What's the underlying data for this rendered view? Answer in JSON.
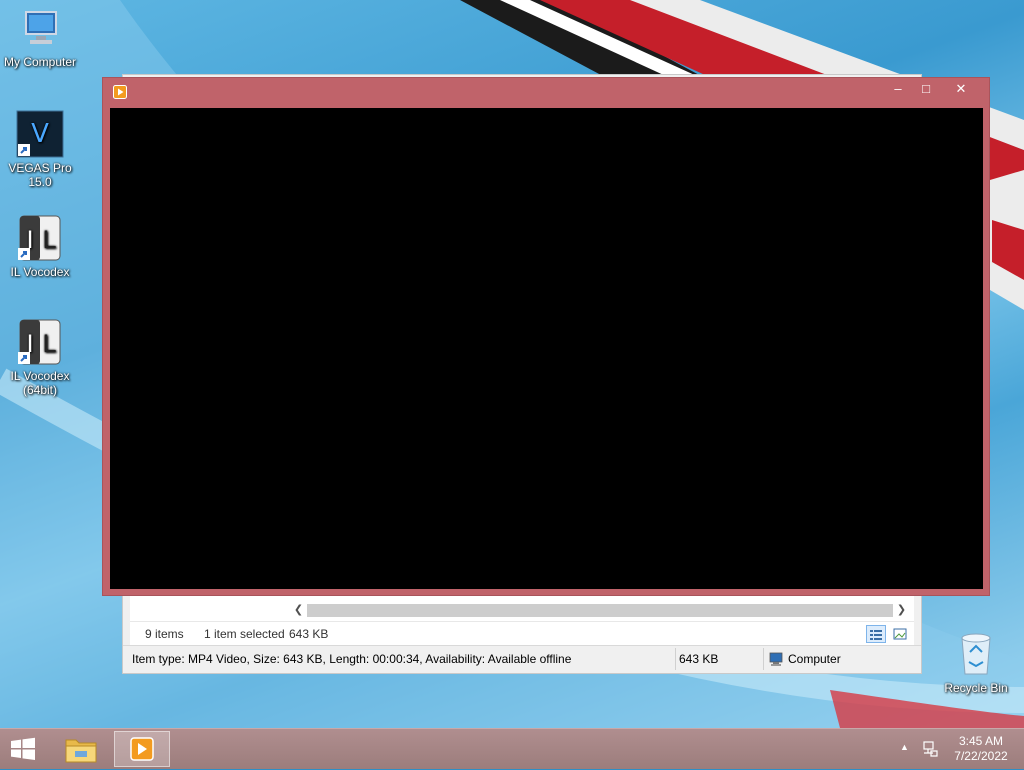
{
  "desktop": {
    "icons": [
      {
        "label": "My Computer",
        "icon": "computer-icon"
      },
      {
        "label_line1": "VEGAS Pro",
        "label_line2": "15.0",
        "icon": "vegas-pro-icon"
      },
      {
        "label": "IL Vocodex",
        "icon": "il-vocodex-icon"
      },
      {
        "label_line1": "IL Vocodex",
        "label_line2": "(64bit)",
        "icon": "il-vocodex-icon"
      },
      {
        "label": "Recycle Bin",
        "icon": "recycle-bin-icon"
      }
    ]
  },
  "explorer": {
    "items_count": "9 items",
    "selection": "1 item selected",
    "selection_size": "643 KB",
    "details": "Item type: MP4 Video, Size: 643 KB, Length: 00:00:34, Availability: Available offline",
    "size": "643 KB",
    "location": "Computer"
  },
  "player": {
    "controls": {
      "minimize": "–",
      "maximize": "□",
      "close": "✕"
    },
    "frame_color": "#c0636a"
  },
  "taskbar": {
    "buttons": [
      {
        "name": "file-explorer",
        "icon": "folder-icon"
      },
      {
        "name": "media-player",
        "icon": "media-player-icon",
        "active": true
      }
    ],
    "clock": {
      "time": "3:45 AM",
      "date": "7/22/2022"
    }
  }
}
